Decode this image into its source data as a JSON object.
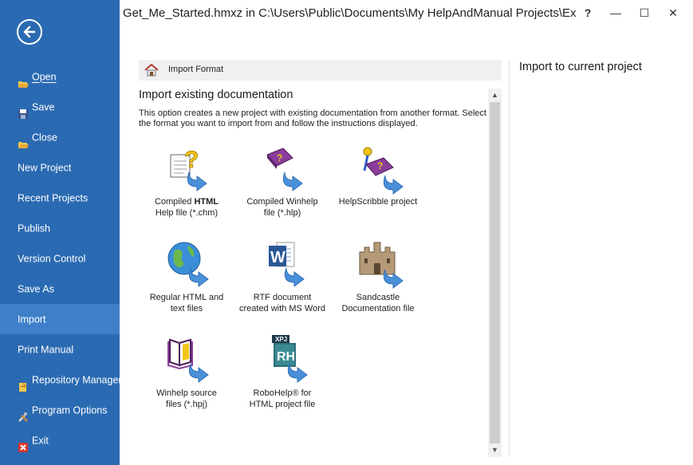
{
  "window": {
    "title": "Get_Me_Started.hmxz in C:\\Users\\Public\\Documents\\My HelpAndManual Projects\\Ex...",
    "help": "?",
    "minimize": "—",
    "maximize": "☐",
    "close": "✕"
  },
  "sidebar": {
    "items": [
      {
        "label": "Open",
        "icon": "folder-open-icon"
      },
      {
        "label": "Save",
        "icon": "floppy-disk-icon"
      },
      {
        "label": "Close",
        "icon": "folder-close-icon"
      },
      {
        "label": "New Project"
      },
      {
        "label": "Recent Projects"
      },
      {
        "label": "Publish"
      },
      {
        "label": "Version Control"
      },
      {
        "label": "Save As"
      },
      {
        "label": "Import",
        "active": true
      },
      {
        "label": "Print Manual"
      },
      {
        "label": "Repository Manager",
        "icon": "repository-icon"
      },
      {
        "label": "Program Options",
        "icon": "tools-icon"
      },
      {
        "label": "Exit",
        "icon": "exit-icon"
      }
    ]
  },
  "panel": {
    "header": "Import Format",
    "title": "Import existing documentation",
    "description": "This option creates a new project with existing documentation from another format. Select the format you want to import from and follow the instructions displayed.",
    "right_title": "Import to current project"
  },
  "formats": {
    "chm": {
      "line1_pre": "Compiled ",
      "line1_bold": "HTML",
      "line2": "Help file (*.chm)"
    },
    "hlp": {
      "line1": "Compiled Winhelp",
      "line2": "file (*.hlp)"
    },
    "helpscribble": {
      "line1": "HelpScribble project"
    },
    "html": {
      "line1": "Regular HTML and",
      "line2": "text files"
    },
    "rtf": {
      "line1": "RTF document",
      "line2": "created with MS Word"
    },
    "sandcastle": {
      "line1": "Sandcastle",
      "line2": "Documentation file"
    },
    "hpj": {
      "line1": "Winhelp source",
      "line2": "files (*.hpj)"
    },
    "robohelp": {
      "line1": "RoboHelp® for",
      "line2": "HTML project file",
      "badge_top": "XPJ",
      "badge_main": "RH"
    }
  },
  "colors": {
    "sidebar": "#2a6ab2",
    "active": "#3f7fc9",
    "arrow": "#4a90d9"
  }
}
